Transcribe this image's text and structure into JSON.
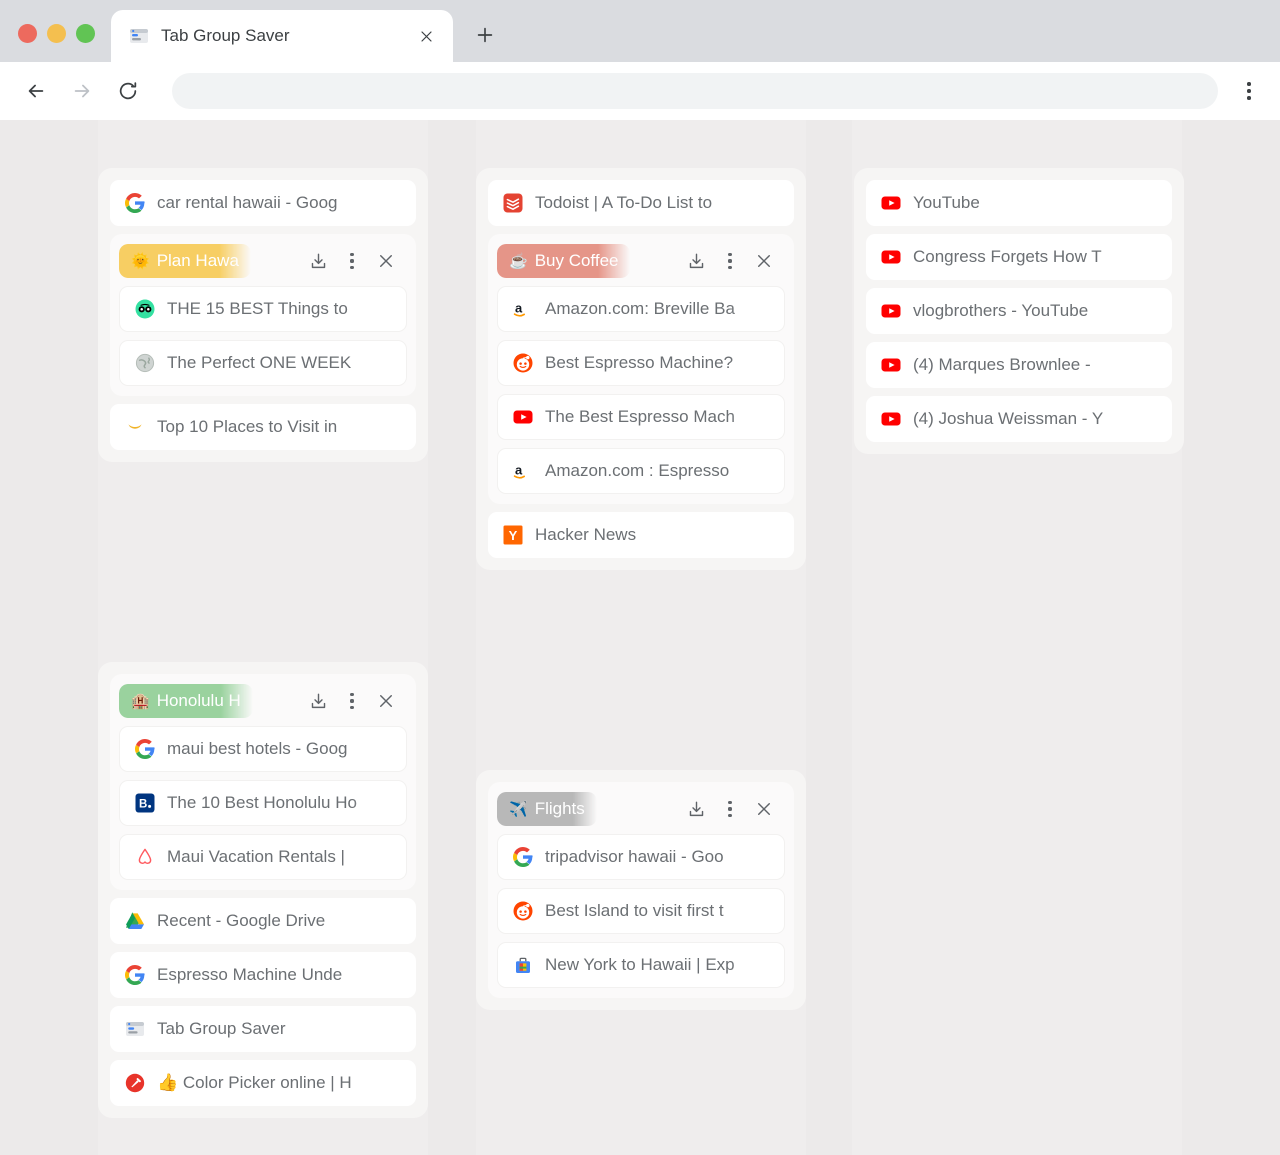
{
  "window": {
    "tab": {
      "title": "Tab Group Saver",
      "favicon": "tab-group-saver-icon",
      "close_label": "×"
    },
    "new_tab_label": "+",
    "toolbar": {
      "back_label": "←",
      "forward_label": "→",
      "reload_label": "↻",
      "address_value": "",
      "address_placeholder": "",
      "menu_label": "⋮"
    }
  },
  "actions": {
    "download": "download-icon",
    "more": "more-icon",
    "close": "close-icon"
  },
  "colors": {
    "page_bg": "#eceaea",
    "card_bg": "#f6f5f4",
    "group_bg": "#fbfafa",
    "tab_bg": "#ffffff",
    "text": "#6b6f73",
    "group_yellow": "#f7ce63",
    "group_salmon": "#e59588",
    "group_green": "#9ad29e",
    "group_grey": "#b8b8b8"
  },
  "columns": [
    {
      "cards": [
        {
          "name": "hawaii-card",
          "blocks": [
            {
              "type": "tab",
              "favicon": "google",
              "label": "car rental hawaii - Goog"
            },
            {
              "type": "group",
              "pill": {
                "emoji": "🌞",
                "label": "Plan Hawa",
                "color": "#f7ce63"
              },
              "tabs": [
                {
                  "favicon": "tripadvisor",
                  "label": "THE 15 BEST Things to "
                },
                {
                  "favicon": "globe",
                  "label": "The Perfect ONE WEEK"
                }
              ]
            },
            {
              "type": "tab",
              "favicon": "crescent",
              "label": "Top 10 Places to Visit in"
            }
          ]
        },
        {
          "name": "honolulu-card",
          "blocks": [
            {
              "type": "group",
              "pill": {
                "emoji": "🏨",
                "label": "Honolulu H",
                "color": "#9ad29e"
              },
              "tabs": [
                {
                  "favicon": "google",
                  "label": "maui best hotels - Goog"
                },
                {
                  "favicon": "booking",
                  "label": "The 10 Best Honolulu Ho"
                },
                {
                  "favicon": "airbnb",
                  "label": "Maui Vacation Rentals |"
                }
              ]
            },
            {
              "type": "tab",
              "favicon": "gdrive",
              "label": "Recent - Google Drive"
            },
            {
              "type": "tab",
              "favicon": "google",
              "label": "Espresso Machine Unde"
            },
            {
              "type": "tab",
              "favicon": "tabgroupsaver",
              "label": "Tab Group Saver"
            },
            {
              "type": "tab",
              "favicon": "colorpicker",
              "label": "👍 Color Picker online | H"
            }
          ]
        }
      ]
    },
    {
      "cards": [
        {
          "name": "coffee-card",
          "blocks": [
            {
              "type": "tab",
              "favicon": "todoist",
              "label": "Todoist | A To-Do List to"
            },
            {
              "type": "group",
              "pill": {
                "emoji": "☕",
                "label": "Buy Coffee",
                "color": "#e59588"
              },
              "tabs": [
                {
                  "favicon": "amazon",
                  "label": "Amazon.com: Breville Ba"
                },
                {
                  "favicon": "reddit",
                  "label": "Best Espresso Machine?"
                },
                {
                  "favicon": "youtube",
                  "label": "The Best Espresso Mach"
                },
                {
                  "favicon": "amazon",
                  "label": "Amazon.com : Espresso"
                }
              ]
            },
            {
              "type": "tab",
              "favicon": "hackernews",
              "label": "Hacker News"
            }
          ]
        },
        {
          "name": "flights-card",
          "blocks": [
            {
              "type": "group",
              "pill": {
                "emoji": "✈️",
                "label": "Flights",
                "color": "#b8b8b8"
              },
              "tabs": [
                {
                  "favicon": "google",
                  "label": "tripadvisor hawaii - Goo"
                },
                {
                  "favicon": "reddit",
                  "label": "Best Island to visit first t"
                },
                {
                  "favicon": "googleflights",
                  "label": "New York to Hawaii | Exp"
                }
              ]
            }
          ]
        }
      ]
    },
    {
      "cards": [
        {
          "name": "youtube-card",
          "blocks": [
            {
              "type": "tab",
              "favicon": "youtube",
              "label": "YouTube"
            },
            {
              "type": "tab",
              "favicon": "youtube",
              "label": "Congress Forgets How T"
            },
            {
              "type": "tab",
              "favicon": "youtube",
              "label": "vlogbrothers - YouTube"
            },
            {
              "type": "tab",
              "favicon": "youtube",
              "label": "(4) Marques Brownlee - "
            },
            {
              "type": "tab",
              "favicon": "youtube",
              "label": "(4) Joshua Weissman - Y"
            }
          ]
        }
      ]
    }
  ]
}
